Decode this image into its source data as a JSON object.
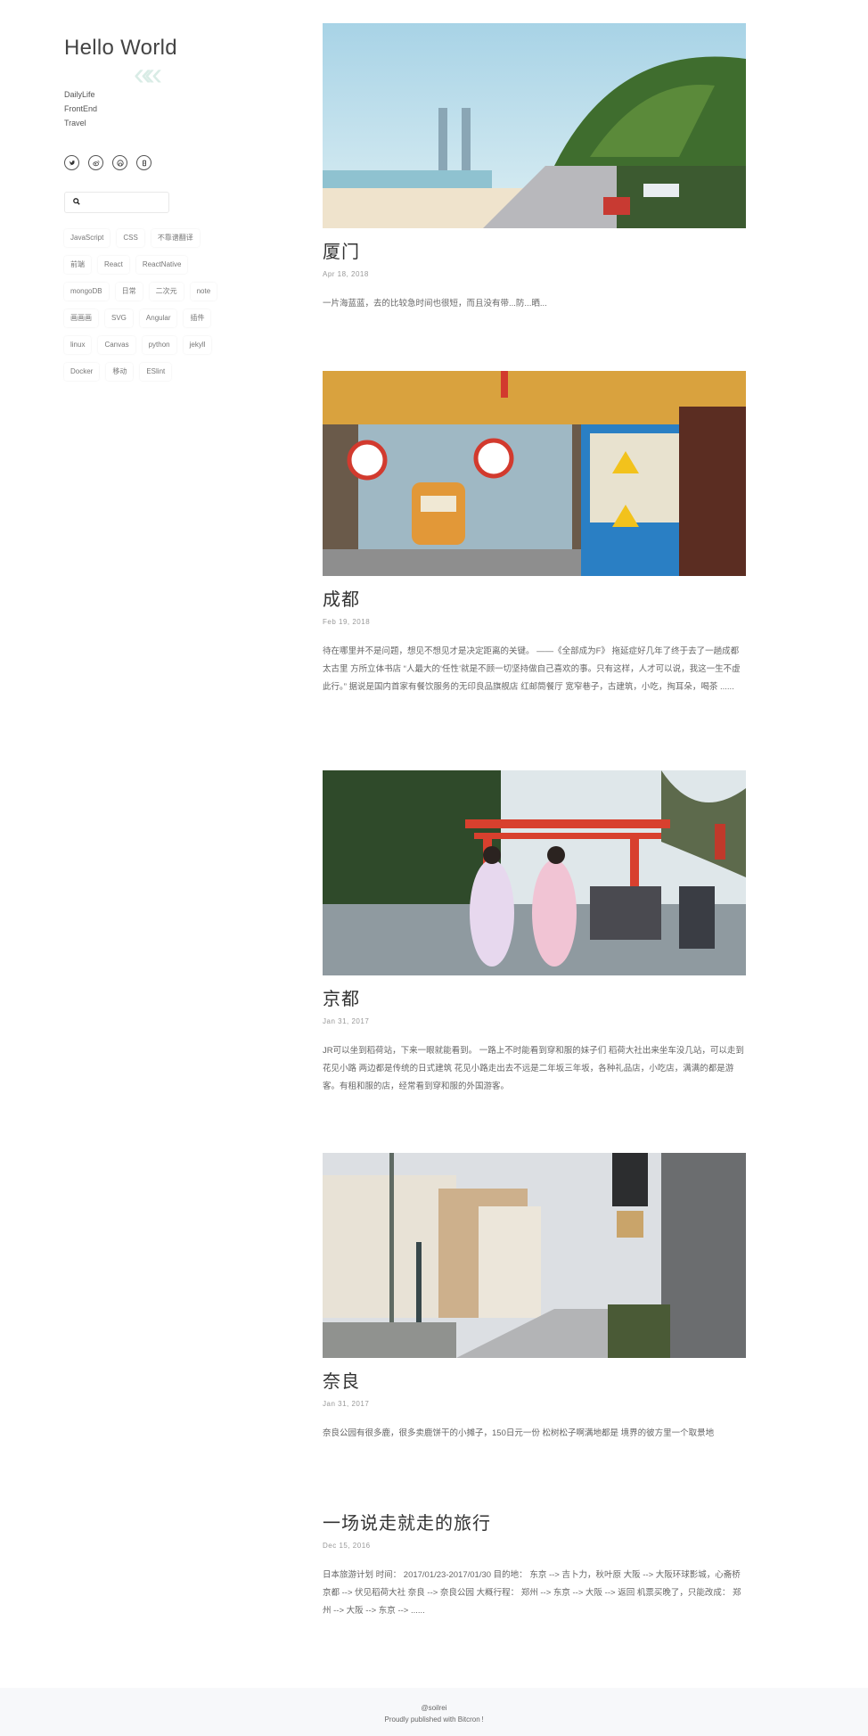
{
  "site": {
    "title": "Hello World",
    "deco": "««",
    "nav": [
      "DailyLife",
      "FrontEnd",
      "Travel"
    ],
    "social_icons": [
      "twitter-icon",
      "weibo-icon",
      "github-icon",
      "zhihu-icon"
    ],
    "search_icon": "search-icon",
    "search_placeholder": "",
    "tags": [
      "JavaScript",
      "CSS",
      "不靠谱翻译",
      "前端",
      "React",
      "ReactNative",
      "mongoDB",
      "日常",
      "二次元",
      "note",
      "画画画",
      "SVG",
      "Angular",
      "插件",
      "linux",
      "Canvas",
      "python",
      "jekyll",
      "Docker",
      "移动",
      "ESlint"
    ]
  },
  "posts": [
    {
      "title": "厦门",
      "date": "Apr 18, 2018",
      "excerpt": "一片海蓝蓝，去的比较急时间也很短，而且没有带...防...晒..."
    },
    {
      "title": "成都",
      "date": "Feb 19, 2018",
      "excerpt": "待在哪里并不是问题，想见不想见才是决定距离的关键。 ——《全部成为F》 拖延症好几年了终于去了一趟成都 太古里 方所立体书店 “人最大的‘任性’就是不顾一切坚持做自己喜欢的事。只有这样，人才可以说，我这一生不虚此行。” 据说是国内首家有餐饮服务的无印良品旗舰店 红邮筒餐厅 宽窄巷子，古建筑，小吃，掏耳朵，喝茶 ......"
    },
    {
      "title": "京都",
      "date": "Jan 31, 2017",
      "excerpt": "JR可以坐到稻荷站，下来一眼就能看到。 一路上不时能看到穿和服的妹子们 稻荷大社出来坐车没几站，可以走到花见小路 两边都是传统的日式建筑 花见小路走出去不远是二年坂三年坂，各种礼品店，小吃店，满满的都是游客。有租和服的店，经常看到穿和服的外国游客。"
    },
    {
      "title": "奈良",
      "date": "Jan 31, 2017",
      "excerpt": "奈良公园有很多鹿，很多卖鹿饼干的小摊子，150日元一份 松树松子啊满地都是 境界的彼方里一个取景地"
    },
    {
      "title": "一场说走就走的旅行",
      "date": "Dec 15, 2016",
      "excerpt": "日本旅游计划 时间： 2017/01/23-2017/01/30 目的地： 东京 --> 吉卜力，秋叶原 大阪 --> 大阪环球影城，心斋桥 京都 --> 伏见稻荷大社 奈良 --> 奈良公园 大概行程： 郑州 --> 东京 --> 大阪 --> 返回 机票买晚了，只能改成： 郑州 --> 大阪 --> 东京 --> ......"
    }
  ],
  "footer": {
    "handle": "@soilrei",
    "credit": "Proudly published with Bitcron !"
  }
}
